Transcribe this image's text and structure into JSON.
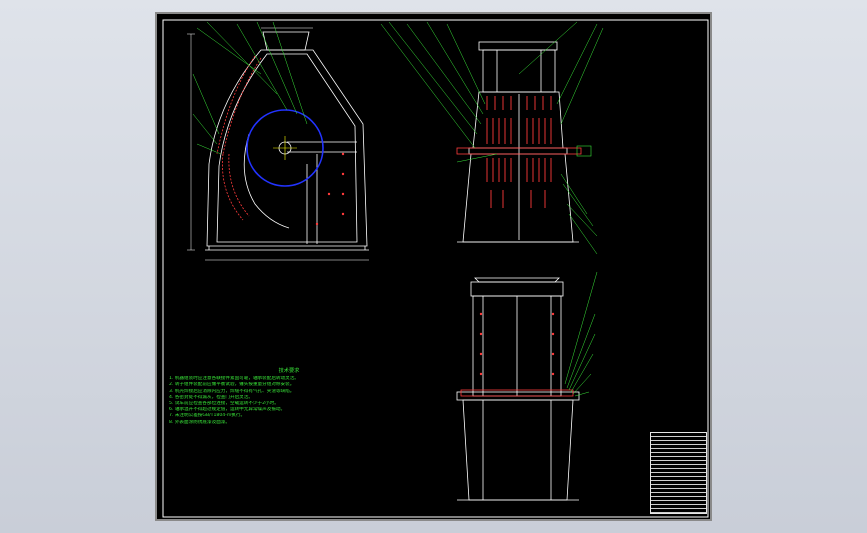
{
  "window": {
    "background": "#d6dbe3"
  },
  "drawing": {
    "colors": {
      "outline": "#ffffff",
      "leader": "#39e639",
      "hidden": "#ff3b3b",
      "rotor": "#2233ff",
      "text": "#39e639",
      "accent": "#ffff00"
    },
    "tech_notes_title": "技术要求",
    "tech_notes": [
      "1. 机器组装时应注意各联接件紧固可靠，轴承装配后转动灵活。",
      "2. 转子组件装配前应做平衡试验，锤头按重量分组对称安装。",
      "3. 机壳焊接后应消除内应力，焊缝不得有气孔、夹渣等缺陷。",
      "4. 各密封处不得漏灰，检查门开启灵活。",
      "5. 试车前应检查各部位连接，空载运转不少于2小时。",
      "6. 轴承温升不得超过规定值，运转中无异常噪声及振动。",
      "7. 未注明公差按GB/T1804-m执行。",
      "8. 外表面涂防锈底漆及面漆。"
    ]
  }
}
